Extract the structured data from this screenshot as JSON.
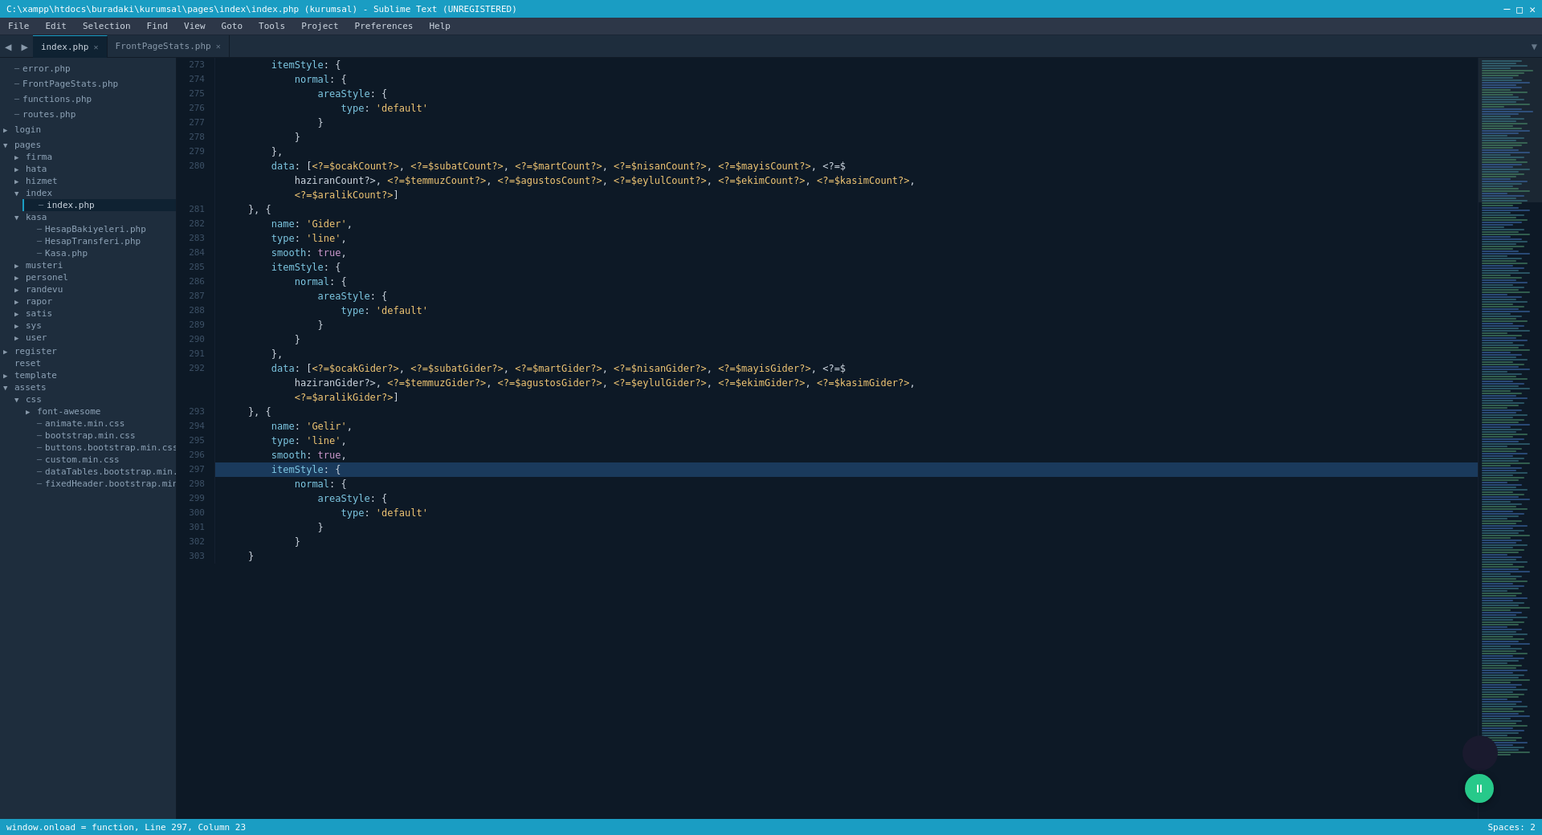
{
  "titleBar": {
    "title": "C:\\xampp\\htdocs\\buradaki\\kurumsal\\pages\\index\\index.php (kurumsal) - Sublime Text (UNREGISTERED)",
    "controls": [
      "─",
      "□",
      "✕"
    ]
  },
  "menuBar": {
    "items": [
      "File",
      "Edit",
      "Selection",
      "Find",
      "View",
      "Goto",
      "Tools",
      "Project",
      "Preferences",
      "Help"
    ]
  },
  "tabs": {
    "activeTab": "index.php",
    "items": [
      {
        "label": "index.php",
        "active": true
      },
      {
        "label": "FrontPageStats.php",
        "active": false
      }
    ]
  },
  "sidebar": {
    "items": [
      {
        "type": "file",
        "label": "error.php",
        "indent": 1
      },
      {
        "type": "file",
        "label": "FrontPageStats.php",
        "indent": 1
      },
      {
        "type": "file",
        "label": "functions.php",
        "indent": 1
      },
      {
        "type": "file",
        "label": "routes.php",
        "indent": 1
      },
      {
        "type": "folder",
        "label": "login",
        "open": false,
        "indent": 0
      },
      {
        "type": "folder",
        "label": "pages",
        "open": true,
        "indent": 0
      },
      {
        "type": "folder",
        "label": "firma",
        "open": false,
        "indent": 1
      },
      {
        "type": "folder",
        "label": "hata",
        "open": false,
        "indent": 1
      },
      {
        "type": "folder",
        "label": "hizmet",
        "open": false,
        "indent": 1
      },
      {
        "type": "folder",
        "label": "index",
        "open": true,
        "indent": 1
      },
      {
        "type": "file",
        "label": "index.php",
        "indent": 2,
        "active": true
      },
      {
        "type": "folder",
        "label": "kasa",
        "open": true,
        "indent": 1
      },
      {
        "type": "file",
        "label": "HesapBakiyeleri.php",
        "indent": 2
      },
      {
        "type": "file",
        "label": "HesapTransferi.php",
        "indent": 2
      },
      {
        "type": "file",
        "label": "Kasa.php",
        "indent": 2
      },
      {
        "type": "folder",
        "label": "musteri",
        "open": false,
        "indent": 1
      },
      {
        "type": "folder",
        "label": "personel",
        "open": false,
        "indent": 1
      },
      {
        "type": "folder",
        "label": "randevu",
        "open": false,
        "indent": 1
      },
      {
        "type": "folder",
        "label": "rapor",
        "open": false,
        "indent": 1
      },
      {
        "type": "folder",
        "label": "satis",
        "open": false,
        "indent": 1
      },
      {
        "type": "folder",
        "label": "sys",
        "open": false,
        "indent": 1
      },
      {
        "type": "folder",
        "label": "user",
        "open": false,
        "indent": 1
      },
      {
        "type": "folder",
        "label": "register",
        "open": false,
        "indent": 0
      },
      {
        "type": "folder",
        "label": "reset",
        "open": false,
        "indent": 0
      },
      {
        "type": "folder",
        "label": "template",
        "open": false,
        "indent": 0
      },
      {
        "type": "folder",
        "label": "assets",
        "open": true,
        "indent": 0
      },
      {
        "type": "folder",
        "label": "css",
        "open": true,
        "indent": 1
      },
      {
        "type": "folder",
        "label": "font-awesome",
        "open": false,
        "indent": 2
      },
      {
        "type": "file",
        "label": "animate.min.css",
        "indent": 2
      },
      {
        "type": "file",
        "label": "bootstrap.min.css",
        "indent": 2
      },
      {
        "type": "file",
        "label": "buttons.bootstrap.min.css",
        "indent": 2
      },
      {
        "type": "file",
        "label": "custom.min.css",
        "indent": 2
      },
      {
        "type": "file",
        "label": "dataTables.bootstrap.min.css",
        "indent": 2
      },
      {
        "type": "file",
        "label": "fixedHeader.bootstrap.min.css",
        "indent": 2
      }
    ]
  },
  "codeLines": [
    {
      "num": 273,
      "content": "        itemStyle: {",
      "highlighted": false
    },
    {
      "num": 274,
      "content": "            normal: {",
      "highlighted": false
    },
    {
      "num": 275,
      "content": "                areaStyle: {",
      "highlighted": false
    },
    {
      "num": 276,
      "content": "                    type: 'default'",
      "highlighted": false
    },
    {
      "num": 277,
      "content": "                }",
      "highlighted": false
    },
    {
      "num": 278,
      "content": "            }",
      "highlighted": false
    },
    {
      "num": 279,
      "content": "        },",
      "highlighted": false
    },
    {
      "num": 280,
      "content": "        data: [<?=$ocakCount?>, <?=$subatCount?>, <?=$martCount?>, <?=$nisanCount?>, <?=$mayisCount?>, <?=$",
      "highlighted": false
    },
    {
      "num": null,
      "content": "            haziranCount?>, <?=$temmuzCount?>, <?=$agustosCount?>, <?=$eylulCount?>, <?=$ekimCount?>, <?=$kasimCount?>,",
      "highlighted": false
    },
    {
      "num": null,
      "content": "            <?=$aralikCount?>]",
      "highlighted": false
    },
    {
      "num": 281,
      "content": "    }, {",
      "highlighted": false
    },
    {
      "num": 282,
      "content": "        name: 'Gider',",
      "highlighted": false
    },
    {
      "num": 283,
      "content": "        type: 'line',",
      "highlighted": false
    },
    {
      "num": 284,
      "content": "        smooth: true,",
      "highlighted": false
    },
    {
      "num": 285,
      "content": "        itemStyle: {",
      "highlighted": false
    },
    {
      "num": 286,
      "content": "            normal: {",
      "highlighted": false
    },
    {
      "num": 287,
      "content": "                areaStyle: {",
      "highlighted": false
    },
    {
      "num": 288,
      "content": "                    type: 'default'",
      "highlighted": false
    },
    {
      "num": 289,
      "content": "                }",
      "highlighted": false
    },
    {
      "num": 290,
      "content": "            }",
      "highlighted": false
    },
    {
      "num": 291,
      "content": "        },",
      "highlighted": false
    },
    {
      "num": 292,
      "content": "        data: [<?=$ocakGider?>, <?=$subatGider?>, <?=$martGider?>, <?=$nisanGider?>, <?=$mayisGider?>, <?=$",
      "highlighted": false
    },
    {
      "num": null,
      "content": "            haziranGider?>, <?=$temmuzGider?>, <?=$agustosGider?>, <?=$eylulGider?>, <?=$ekimGider?>, <?=$kasimGider?>,",
      "highlighted": false
    },
    {
      "num": null,
      "content": "            <?=$aralikGider?>]",
      "highlighted": false
    },
    {
      "num": 293,
      "content": "    }, {",
      "highlighted": false
    },
    {
      "num": 294,
      "content": "        name: 'Gelir',",
      "highlighted": false
    },
    {
      "num": 295,
      "content": "        type: 'line',",
      "highlighted": false
    },
    {
      "num": 296,
      "content": "        smooth: true,",
      "highlighted": false
    },
    {
      "num": 297,
      "content": "        itemStyle: {",
      "highlighted": true
    },
    {
      "num": 298,
      "content": "            normal: {",
      "highlighted": false
    },
    {
      "num": 299,
      "content": "                areaStyle: {",
      "highlighted": false
    },
    {
      "num": 300,
      "content": "                    type: 'default'",
      "highlighted": false
    },
    {
      "num": 301,
      "content": "                }",
      "highlighted": false
    },
    {
      "num": 302,
      "content": "            }",
      "highlighted": false
    },
    {
      "num": 303,
      "content": "    }",
      "highlighted": false
    }
  ],
  "statusBar": {
    "left": "window.onload = function, Line 297, Column 23",
    "right": "Spaces: 2"
  }
}
